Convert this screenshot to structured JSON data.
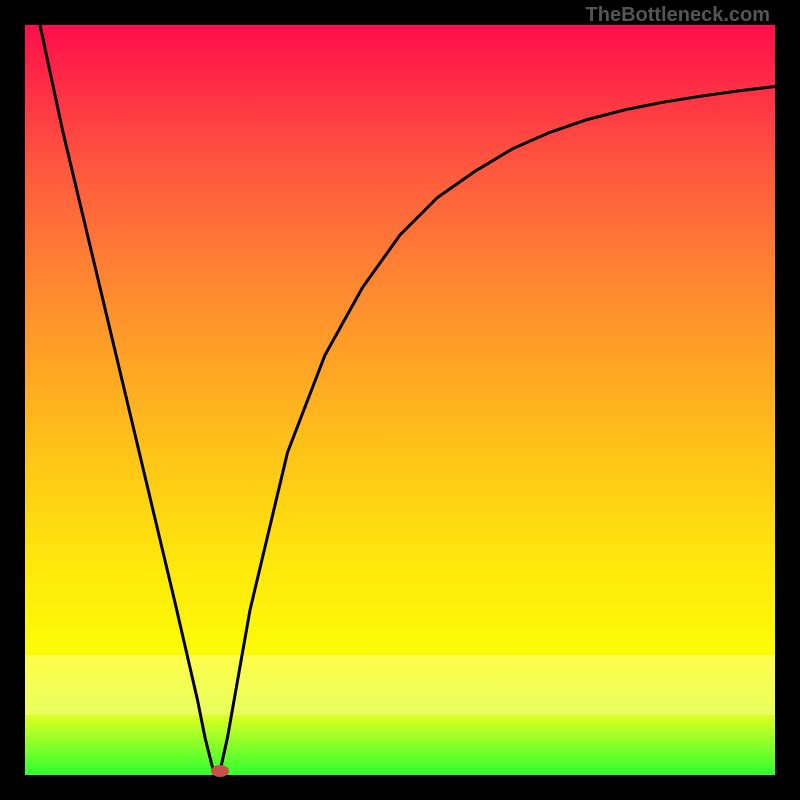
{
  "brand": "TheBottleneck.com",
  "colors": {
    "curve_stroke": "#000000",
    "marker_fill": "#c8504b",
    "gradient_top": "#ff0e4c",
    "gradient_bottom": "#2fff2f"
  },
  "chart_data": {
    "type": "line",
    "title": "",
    "xlabel": "",
    "ylabel": "",
    "xlim": [
      0,
      100
    ],
    "ylim": [
      0,
      100
    ],
    "grid": false,
    "legend": false,
    "x": [
      2,
      5,
      10,
      15,
      20,
      23,
      24,
      25,
      26,
      27,
      30,
      35,
      40,
      45,
      50,
      55,
      60,
      65,
      70,
      75,
      80,
      85,
      90,
      95,
      100
    ],
    "values": [
      100,
      86,
      65,
      44,
      23,
      10,
      5,
      1,
      0.5,
      5,
      22,
      43,
      56,
      65,
      72,
      77,
      80.5,
      83.5,
      85.7,
      87.4,
      88.7,
      89.7,
      90.5,
      91.2,
      91.8
    ],
    "marker": {
      "x": 26,
      "y": 0.5
    }
  }
}
